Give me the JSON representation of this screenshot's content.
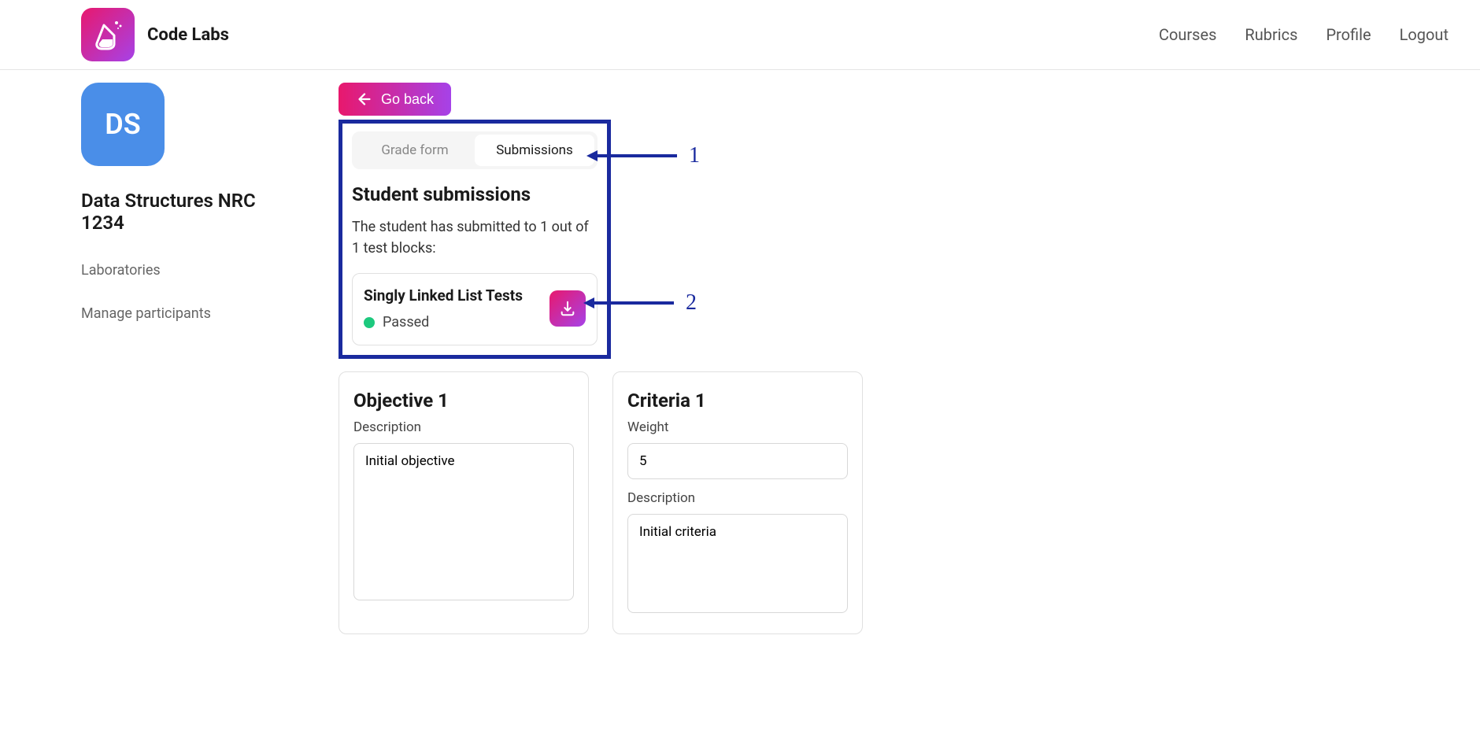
{
  "header": {
    "logo_text": "Code Labs",
    "nav": {
      "courses": "Courses",
      "rubrics": "Rubrics",
      "profile": "Profile",
      "logout": "Logout"
    }
  },
  "sidebar": {
    "course_initials": "DS",
    "course_title": "Data Structures NRC 1234",
    "links": {
      "laboratories": "Laboratories",
      "manage_participants": "Manage participants"
    }
  },
  "main": {
    "go_back": "Go back",
    "tabs": {
      "grade_form": "Grade form",
      "submissions": "Submissions"
    },
    "submissions_section": {
      "title": "Student submissions",
      "description": "The student has submitted to 1 out of 1 test blocks:",
      "test_block": {
        "title": "Singly Linked List Tests",
        "status": "Passed"
      }
    },
    "objective_card": {
      "title": "Objective 1",
      "description_label": "Description",
      "description_value": "Initial objective"
    },
    "criteria_card": {
      "title": "Criteria 1",
      "weight_label": "Weight",
      "weight_value": "5",
      "description_label": "Description",
      "description_value": "Initial criteria"
    },
    "annotations": {
      "one": "1",
      "two": "2"
    }
  }
}
